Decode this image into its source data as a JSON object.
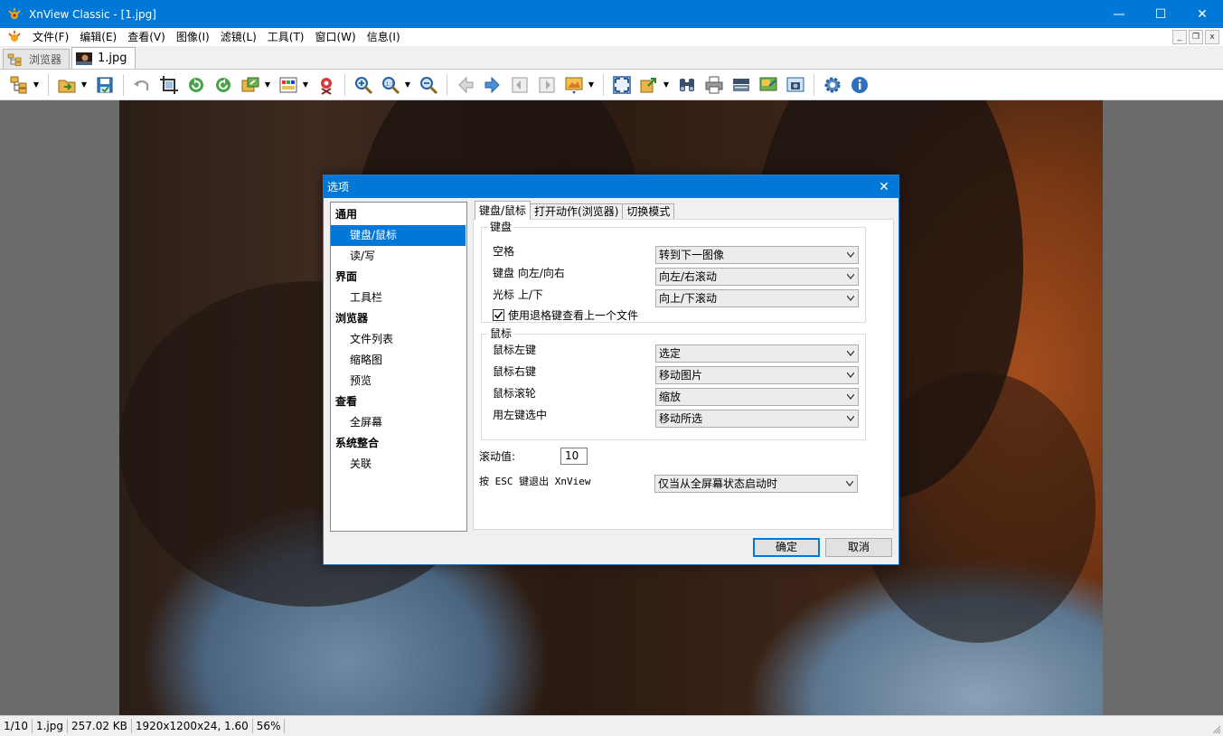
{
  "window": {
    "title": "XnView Classic - [1.jpg]",
    "accent": "#0078d7",
    "controls": {
      "minimize": "—",
      "maximize": "☐",
      "close": "✕"
    }
  },
  "menubar": {
    "items": [
      "文件(F)",
      "编辑(E)",
      "查看(V)",
      "图像(I)",
      "滤镜(L)",
      "工具(T)",
      "窗口(W)",
      "信息(I)"
    ]
  },
  "doc_tabs": [
    {
      "label": "浏览器",
      "icon": "browser-tree-icon",
      "active": false
    },
    {
      "label": "1.jpg",
      "icon": "image-thumb-icon",
      "active": true
    }
  ],
  "toolbar": {
    "buttons": [
      "browser-icon",
      "open-icon",
      "save-icon",
      "undo-icon",
      "crop-icon",
      "rotate-left-icon",
      "rotate-right-icon",
      "convert-icon",
      "adjust-icon",
      "redeye-icon",
      "zoom-in-icon",
      "zoom-actual-icon",
      "zoom-out-icon",
      "previous-icon",
      "next-icon",
      "first-icon",
      "last-icon",
      "slideshow-icon",
      "fullscreen-icon",
      "export-icon",
      "find-icon",
      "print-icon",
      "scanner-icon",
      "wallpaper-icon",
      "capture-icon",
      "settings-icon",
      "info-icon"
    ]
  },
  "dialog": {
    "title": "选项",
    "close": "✕",
    "tree": [
      {
        "label": "通用",
        "level": 0
      },
      {
        "label": "键盘/鼠标",
        "level": 1,
        "selected": true
      },
      {
        "label": "读/写",
        "level": 1
      },
      {
        "label": "界面",
        "level": 0
      },
      {
        "label": "工具栏",
        "level": 1
      },
      {
        "label": "浏览器",
        "level": 0
      },
      {
        "label": "文件列表",
        "level": 1
      },
      {
        "label": "缩略图",
        "level": 1
      },
      {
        "label": "预览",
        "level": 1
      },
      {
        "label": "查看",
        "level": 0
      },
      {
        "label": "全屏幕",
        "level": 1
      },
      {
        "label": "系统整合",
        "level": 0
      },
      {
        "label": "关联",
        "level": 1
      }
    ],
    "tabs": [
      "键盘/鼠标",
      "打开动作(浏览器)",
      "切换模式"
    ],
    "keyboard": {
      "group_title": "键盘",
      "rows": [
        {
          "label": "空格",
          "value": "转到下一图像"
        },
        {
          "label": "键盘 向左/向右",
          "value": "向左/右滚动"
        },
        {
          "label": "光标 上/下",
          "value": "向上/下滚动"
        }
      ],
      "checkbox_label": "使用退格键查看上一个文件",
      "checkbox_checked": true
    },
    "mouse": {
      "group_title": "鼠标",
      "rows": [
        {
          "label": "鼠标左键",
          "value": "选定"
        },
        {
          "label": "鼠标右键",
          "value": "移动图片"
        },
        {
          "label": "鼠标滚轮",
          "value": "缩放"
        },
        {
          "label": "用左键选中",
          "value": "移动所选"
        }
      ]
    },
    "scroll_label": "滚动值:",
    "scroll_value": "10",
    "esc_label": "按 ESC 键退出 XnView",
    "esc_value": "仅当从全屏幕状态启动时",
    "ok": "确定",
    "cancel": "取消"
  },
  "statusbar": {
    "cells": [
      "1/10",
      "1.jpg",
      "257.02 KB",
      "1920x1200x24, 1.60",
      "56%"
    ]
  }
}
